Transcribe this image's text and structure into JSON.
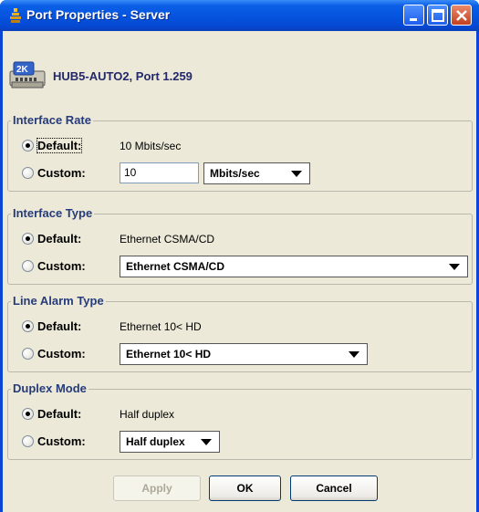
{
  "window": {
    "title": "Port Properties - Server"
  },
  "header": {
    "icon_text": "2K",
    "port_title": "HUB5-AUTO2, Port 1.259"
  },
  "groups": {
    "interface_rate": {
      "legend": "Interface Rate",
      "default_label": "Default:",
      "default_value": "10 Mbits/sec",
      "custom_label": "Custom:",
      "custom_input_value": "10",
      "custom_unit": "Mbits/sec",
      "selected": "default"
    },
    "interface_type": {
      "legend": "Interface Type",
      "default_label": "Default:",
      "default_value": "Ethernet CSMA/CD",
      "custom_label": "Custom:",
      "custom_value": "Ethernet CSMA/CD",
      "selected": "default"
    },
    "line_alarm_type": {
      "legend": "Line Alarm Type",
      "default_label": "Default:",
      "default_value": "Ethernet 10< HD",
      "custom_label": "Custom:",
      "custom_value": "Ethernet 10< HD",
      "selected": "default"
    },
    "duplex_mode": {
      "legend": "Duplex Mode",
      "default_label": "Default:",
      "default_value": "Half duplex",
      "custom_label": "Custom:",
      "custom_value": "Half duplex",
      "selected": "default"
    }
  },
  "buttons": {
    "apply": "Apply",
    "ok": "OK",
    "cancel": "Cancel"
  }
}
